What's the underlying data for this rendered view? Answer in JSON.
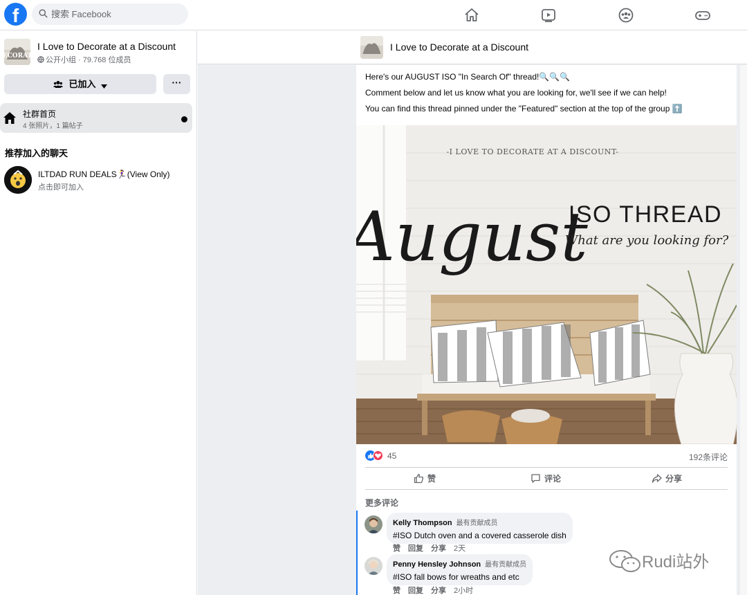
{
  "topbar": {
    "logo": "f",
    "search_placeholder": "搜索 Facebook",
    "nav_icons": [
      "home-icon",
      "watch-icon",
      "groups-icon",
      "gaming-icon"
    ]
  },
  "sidebar": {
    "group_name": "I Love to Decorate at a Discount",
    "group_meta": "公开小组 · 79.768 位成员",
    "joined_label": "已加入",
    "more_label": "···",
    "home": {
      "label": "社群首页",
      "sub": "4 张照片，1 篇帖子"
    },
    "recommended_title": "推荐加入的聊天",
    "chat": {
      "name": "ILTDAD RUN DEALS🏃‍♀️(View Only)",
      "sub": "点击即可加入"
    }
  },
  "group_bar": {
    "title": "I Love to Decorate at a Discount"
  },
  "post": {
    "lines": [
      "Here's our AUGUST ISO \"In Search Of\" thread!🔍🔍🔍",
      "Comment below and let us know what you are looking for, we'll see if we can help!",
      "You can find this thread pinned under the \"Featured\" section at the top of the group ⬆️"
    ],
    "image": {
      "header": "-I LOVE TO DECORATE AT A DISCOUNT-",
      "script_word": "August",
      "headline": "ISO THREAD",
      "subline": "What are you looking for?"
    },
    "reaction_count": "45",
    "comment_count": "192条评论",
    "actions": {
      "like": "赞",
      "comment": "评论",
      "share": "分享"
    },
    "more_comments": "更多评论",
    "comments": [
      {
        "author": "Kelly Thompson",
        "badge": "最有贡献成员",
        "text": "#ISO Dutch oven and a covered casserole dish",
        "like": "赞",
        "reply": "回复",
        "share": "分享",
        "time": "2天"
      },
      {
        "author": "Penny Hensley Johnson",
        "badge": "最有贡献成员",
        "text": "#ISO fall bows for wreaths and etc",
        "like": "赞",
        "reply": "回复",
        "share": "分享",
        "time": "2小时"
      }
    ]
  },
  "watermark": "Rudi站外",
  "colors": {
    "brand": "#1877f2",
    "love": "#f33e58",
    "text_secondary": "#65676b"
  }
}
